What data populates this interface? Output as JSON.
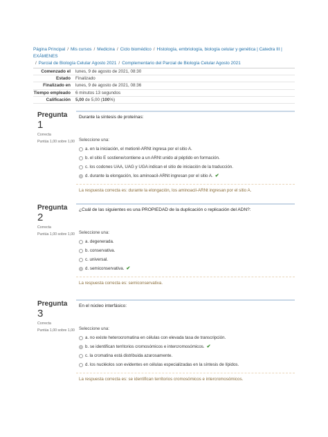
{
  "breadcrumb": [
    "Página Principal",
    "Mis cursos",
    "Medicina",
    "Ciclo biomédico",
    "Histología, embriología, biología celular y genética | Catedra III | EXÁMENES",
    "Parcial de Biología Celular Agosto 2021",
    "Complementario del Parcial de Biología Celular Agosto 2021"
  ],
  "summary": {
    "started_label": "Comenzado el",
    "started": "lunes, 9 de agosto de 2021, 08:30",
    "state_label": "Estado",
    "state": "Finalizado",
    "finished_label": "Finalizado en",
    "finished": "lunes, 9 de agosto de 2021, 08:36",
    "time_label": "Tiempo empleado",
    "time": "6 minutos 13 segundos",
    "grade_label": "Calificación",
    "grade_value": "5,00",
    "grade_of": " de 5,00 (",
    "grade_pct": "100",
    "grade_end": "%)"
  },
  "questions": [
    {
      "label": "Pregunta",
      "num": "1",
      "status": "Correcta",
      "grade": "Puntúa 1,00 sobre 1,00",
      "text": "Durante la síntesis de proteínas:",
      "prompt": "Seleccione una:",
      "options": [
        "a. en la iniciación, el metionil-ARNt ingresa por el sitio A.",
        "b. el sitio E sostiene/contiene a un ARNt unido al péptido en formación.",
        "c. los codones UAA, UAG y UGA indican el sitio de iniciación de la traducción.",
        "d. durante la elongación, los aminoacil-ARNt ingresan por el sitio A."
      ],
      "feedback": "La respuesta correcta es: durante la elongación, los aminoacil-ARNt ingresan por el sitio A."
    },
    {
      "label": "Pregunta",
      "num": "2",
      "status": "Correcta",
      "grade": "Puntúa 1,00 sobre 1,00",
      "text": "¿Cuál de las siguientes es una PROPIEDAD de la duplicación o replicación del ADN?:",
      "prompt": "Seleccione una:",
      "options": [
        "a. degenerada.",
        "b. conservativa.",
        "c. universal.",
        "d. semiconservativa."
      ],
      "feedback": "La respuesta correcta es: semiconservativa."
    },
    {
      "label": "Pregunta",
      "num": "3",
      "status": "Correcta",
      "grade": "Puntúa 1,00 sobre 1,00",
      "text": "En el núcleo interfásico:",
      "prompt": "Seleccione una:",
      "options": [
        "a. no existe heterocromatina en células con elevada tasa de transcripción.",
        "b. se identifican territorios cromosómicos e intercromosómicos.",
        "c. la cromatina está distribuida azarosamente.",
        "d. los nucléolos son evidentes en células especializadas en la síntesis de lípidos."
      ],
      "feedback": "La respuesta correcta es: se identifican territorios cromosómicos e intercromosómicos."
    }
  ],
  "colors": {
    "link": "#1f6fa8",
    "correct": "#3a8d2e",
    "feedback": "#8a6d3b"
  },
  "icons": {
    "correct": "check-icon"
  }
}
